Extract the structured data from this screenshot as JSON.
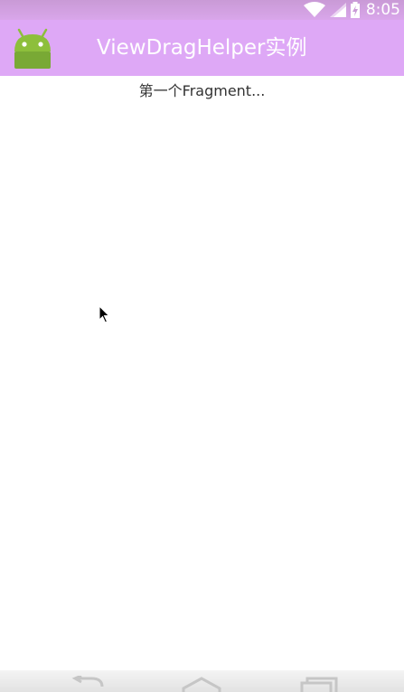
{
  "status_bar": {
    "time": "8:05",
    "icons": [
      "wifi-icon",
      "signal-icon",
      "battery-charging-icon"
    ]
  },
  "action_bar": {
    "title": "ViewDragHelper实例",
    "icon": "android-icon"
  },
  "content": {
    "fragment_text": "第一个Fragment..."
  },
  "nav_bar": {
    "buttons": [
      "back-icon",
      "home-icon",
      "recents-icon"
    ]
  },
  "colors": {
    "action_bar": "#dea8f6",
    "status_bar": "#d9a6ea",
    "android_green": "#8dbf3c"
  }
}
